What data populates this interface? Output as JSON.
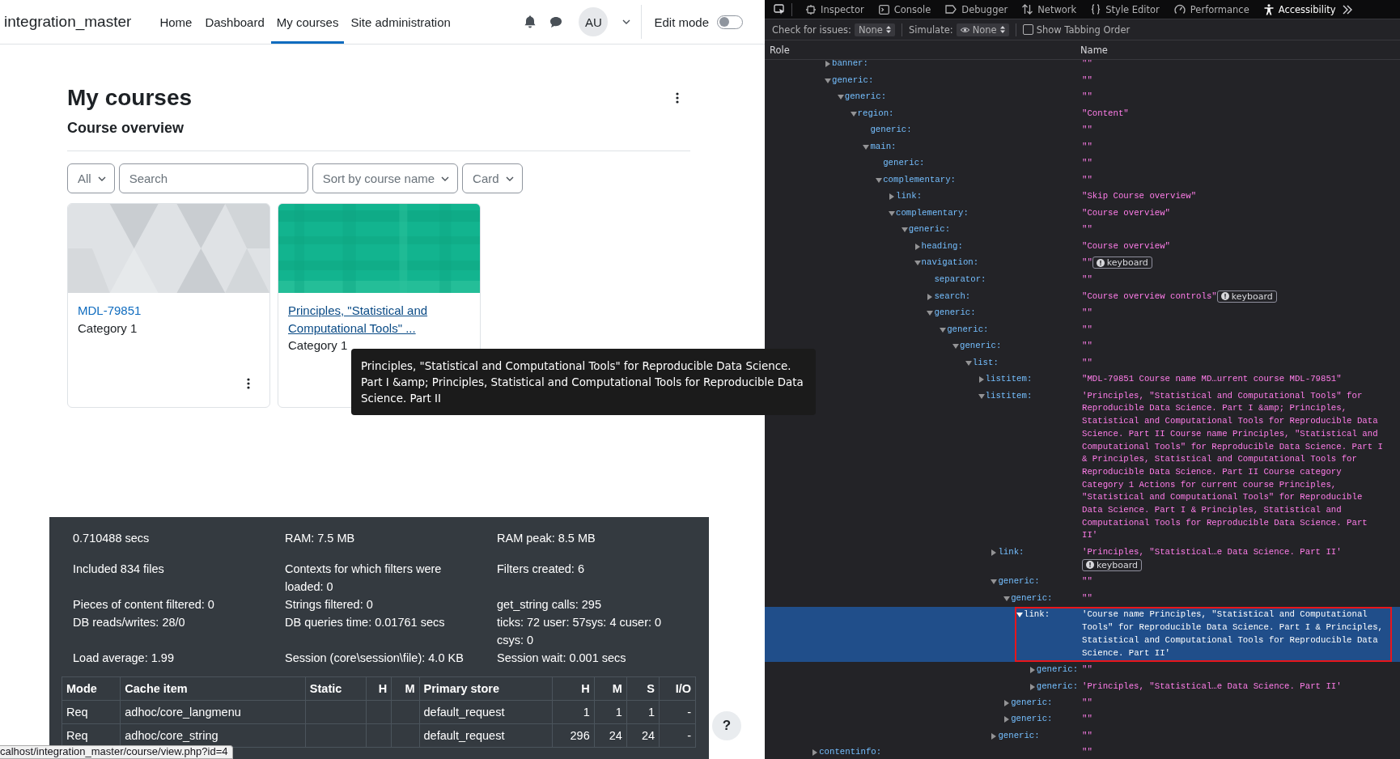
{
  "page": {
    "navbar": {
      "brand": "integration_master",
      "links": [
        {
          "label": "Home",
          "selected": false
        },
        {
          "label": "Dashboard",
          "selected": false
        },
        {
          "label": "My courses",
          "selected": true
        },
        {
          "label": "Site administration",
          "selected": false
        }
      ],
      "avatar": "AU",
      "edit_mode": {
        "label": "Edit mode",
        "on": false
      }
    },
    "heading": "My courses",
    "section_title": "Course overview",
    "filters": {
      "grouping": "All",
      "search_placeholder": "Search",
      "sort": "Sort by course name",
      "view": "Card"
    },
    "courses": [
      {
        "name": "MDL-79851",
        "category": "Category 1",
        "hovered": false
      },
      {
        "name": "Principles, \"Statistical and Computational Tools\" ...",
        "category": "Category 1",
        "hovered": true
      }
    ],
    "tooltip": "Principles, \"Statistical and Computational Tools\" for Reproducible Data Science. Part I &amp; Principles, Statistical and Computational Tools for Reproducible Data Science. Part II",
    "perf": {
      "stats": [
        "0.710488 secs",
        "RAM: 7.5 MB",
        "RAM peak: 8.5 MB",
        "Included 834 files",
        "Contexts for which filters were loaded: 0",
        "Filters created: 6",
        "Pieces of content filtered: 0",
        "Strings filtered: 0",
        "get_string calls: 295",
        "DB reads/writes: 28/0",
        "DB queries time: 0.01761 secs",
        "ticks: 72 user: 57sys: 4 cuser: 0 csys: 0",
        "Load average: 1.99",
        "Session (core\\session\\file): 4.0 KB",
        "Session wait: 0.001 secs"
      ],
      "table": {
        "columns": [
          "Mode",
          "Cache item",
          "Static",
          "H",
          "M",
          "Primary store",
          "H",
          "M",
          "S",
          "I/O"
        ],
        "rows": [
          [
            "Req",
            "adhoc/core_langmenu",
            null,
            null,
            null,
            "default_request",
            "1",
            "1",
            "1",
            "-"
          ],
          [
            "Req",
            "adhoc/core_string",
            null,
            null,
            null,
            "default_request",
            "296",
            "24",
            "24",
            "-"
          ]
        ]
      }
    },
    "status_url": "calhost/integration_master/course/view.php?id=4",
    "help": "?"
  },
  "devtools": {
    "tabs": [
      {
        "label": "Inspector",
        "selected": false
      },
      {
        "label": "Console",
        "selected": false
      },
      {
        "label": "Debugger",
        "selected": false
      },
      {
        "label": "Network",
        "selected": false
      },
      {
        "label": "Style Editor",
        "selected": false
      },
      {
        "label": "Performance",
        "selected": false
      },
      {
        "label": "Accessibility",
        "selected": true
      }
    ],
    "check_for_issues": {
      "label": "Check for issues:",
      "value": "None"
    },
    "simulate": {
      "label": "Simulate:",
      "value": "None"
    },
    "tabbing_order": {
      "label": "Show Tabbing Order",
      "checked": false
    },
    "columns": [
      "Role",
      "Name"
    ],
    "tree": [
      {
        "role": "banner:",
        "name": "\"\"",
        "expanded": false,
        "selected": false
      },
      {
        "role": "generic:",
        "name": "\"\"",
        "expanded": true,
        "selected": false,
        "children": [
          {
            "role": "generic:",
            "name": "\"\"",
            "expanded": true,
            "selected": false,
            "children": [
              {
                "role": "region:",
                "name": "\"Content\"",
                "expanded": true,
                "selected": false,
                "children": [
                  {
                    "role": "generic:",
                    "name": "\"\"",
                    "selected": false
                  },
                  {
                    "role": "main:",
                    "name": "\"\"",
                    "expanded": true,
                    "selected": false,
                    "children": [
                      {
                        "role": "generic:",
                        "name": "\"\"",
                        "selected": false
                      },
                      {
                        "role": "complementary:",
                        "name": "\"\"",
                        "expanded": true,
                        "selected": false,
                        "children": [
                          {
                            "role": "link:",
                            "name": "\"Skip Course overview\"",
                            "expanded": false,
                            "selected": false
                          },
                          {
                            "role": "complementary:",
                            "name": "\"Course overview\"",
                            "expanded": true,
                            "selected": false,
                            "children": [
                              {
                                "role": "generic:",
                                "name": "\"\"",
                                "expanded": true,
                                "selected": false,
                                "children": [
                                  {
                                    "role": "heading:",
                                    "name": "\"Course overview\"",
                                    "expanded": false,
                                    "selected": false
                                  },
                                  {
                                    "role": "navigation:",
                                    "name": "\"\"",
                                    "badge": "keyboard",
                                    "expanded": true,
                                    "selected": false,
                                    "children": [
                                      {
                                        "role": "separator:",
                                        "name": "\"\"",
                                        "selected": false
                                      },
                                      {
                                        "role": "search:",
                                        "name": "\"Course overview controls\"",
                                        "badge": "keyboard",
                                        "expanded": false,
                                        "selected": false
                                      },
                                      {
                                        "role": "generic:",
                                        "name": "\"\"",
                                        "expanded": true,
                                        "selected": false,
                                        "children": [
                                          {
                                            "role": "generic:",
                                            "name": "\"\"",
                                            "expanded": true,
                                            "selected": false,
                                            "children": [
                                              {
                                                "role": "generic:",
                                                "name": "\"\"",
                                                "expanded": true,
                                                "selected": false,
                                                "children": [
                                                  {
                                                    "role": "list:",
                                                    "name": "\"\"",
                                                    "expanded": true,
                                                    "selected": false,
                                                    "children": [
                                                      {
                                                        "role": "listitem:",
                                                        "name": "\"MDL-79851 Course name MD…urrent course MDL-79851\"",
                                                        "expanded": false,
                                                        "selected": false
                                                      },
                                                      {
                                                        "role": "listitem:",
                                                        "name": "'Principles, \"Statistical and Computational Tools\" for Reproducible Data Science. Part I &amp; Principles, Statistical and Computational Tools for Reproducible Data Science. Part II Course name Principles, \"Statistical and Computational Tools\" for Reproducible Data Science. Part I & Principles, Statistical and Computational Tools for Reproducible Data Science. Part II Course category Category 1 Actions for current course Principles, \"Statistical and Computational Tools\" for Reproducible Data Science. Part I & Principles, Statistical and Computational Tools for Reproducible Data Science. Part II'",
                                                        "expanded": true,
                                                        "selected": false,
                                                        "children": [
                                                          {
                                                            "role": "link:",
                                                            "name": "'Principles, \"Statistical…e Data Science. Part II'",
                                                            "badge": "keyboard",
                                                            "expanded": false,
                                                            "selected": false
                                                          },
                                                          {
                                                            "role": "generic:",
                                                            "name": "\"\"",
                                                            "expanded": true,
                                                            "selected": false,
                                                            "children": [
                                                              {
                                                                "role": "generic:",
                                                                "name": "\"\"",
                                                                "expanded": true,
                                                                "selected": false,
                                                                "children": [
                                                                  {
                                                                    "role": "link:",
                                                                    "name": "'Course name Principles, \"Statistical and Computational Tools\" for Reproducible Data Science. Part I & Principles, Statistical and Computational Tools for Reproducible Data Science. Part II'",
                                                                    "expanded": true,
                                                                    "selected": true,
                                                                    "highlighted": true,
                                                                    "children": [
                                                                      {
                                                                        "role": "generic:",
                                                                        "name": "\"\"",
                                                                        "expanded": false,
                                                                        "selected": false
                                                                      },
                                                                      {
                                                                        "role": "generic:",
                                                                        "name": "'Principles, \"Statistical…e Data Science. Part II'",
                                                                        "expanded": false,
                                                                        "selected": false
                                                                      }
                                                                    ]
                                                                  }
                                                                ]
                                                              },
                                                              {
                                                                "role": "generic:",
                                                                "name": "\"\"",
                                                                "expanded": false,
                                                                "selected": false
                                                              },
                                                              {
                                                                "role": "generic:",
                                                                "name": "\"\"",
                                                                "expanded": false,
                                                                "selected": false
                                                              }
                                                            ]
                                                          },
                                                          {
                                                            "role": "generic:",
                                                            "name": "\"\"",
                                                            "expanded": false,
                                                            "selected": false
                                                          }
                                                        ]
                                                      }
                                                    ]
                                                  }
                                                ]
                                              }
                                            ]
                                          }
                                        ]
                                      }
                                    ]
                                  }
                                ]
                              }
                            ]
                          }
                        ]
                      }
                    ]
                  }
                ]
              }
            ]
          }
        ]
      }
    ],
    "outer_nodes": [
      {
        "role": "contentinfo:",
        "name": "\"\"",
        "expanded": false,
        "selected": false
      }
    ]
  }
}
